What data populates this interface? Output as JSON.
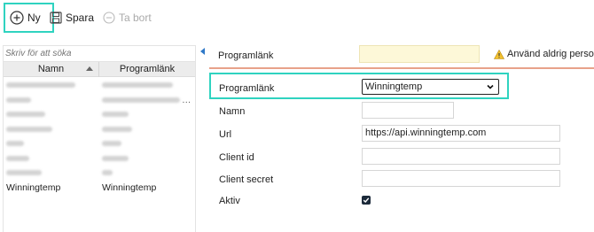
{
  "toolbar": {
    "new_label": "Ny",
    "save_label": "Spara",
    "delete_label": "Ta bort"
  },
  "list": {
    "search_placeholder": "Skriv för att söka",
    "columns": [
      "Namn",
      "Programlänk"
    ],
    "rows": [
      {
        "name": "",
        "program": ""
      },
      {
        "name": "",
        "program": ""
      },
      {
        "name": "",
        "program": ""
      },
      {
        "name": "",
        "program": ""
      },
      {
        "name": "",
        "program": ""
      },
      {
        "name": "",
        "program": ""
      },
      {
        "name": "",
        "program": ""
      },
      {
        "name": "Winningtemp",
        "program": "Winningtemp"
      }
    ]
  },
  "header": {
    "label": "Programlänk",
    "warning": "Använd aldrig personliga"
  },
  "form": {
    "programlank_label": "Programlänk",
    "programlank_value": "Winningtemp",
    "namn_label": "Namn",
    "namn_value": "",
    "url_label": "Url",
    "url_value": "https://api.winningtemp.com",
    "client_id_label": "Client id",
    "client_id_value": "",
    "client_secret_label": "Client secret",
    "client_secret_value": "",
    "aktiv_label": "Aktiv"
  },
  "colors": {
    "highlight": "#2fd3c0",
    "warning_bg": "#fdf8d8",
    "divider": "#e8a28a"
  }
}
